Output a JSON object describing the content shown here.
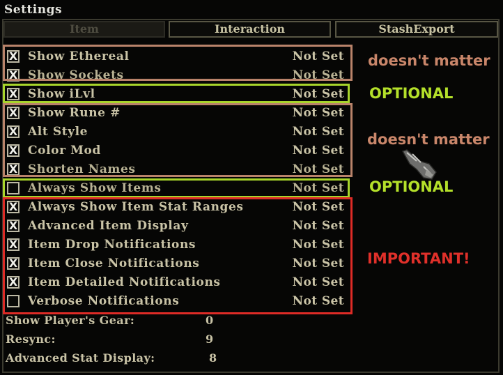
{
  "window": {
    "title": "Settings"
  },
  "tabs": [
    {
      "label": "Item",
      "active": true
    },
    {
      "label": "Interaction",
      "active": false
    },
    {
      "label": "StashExport",
      "active": false
    }
  ],
  "options": [
    {
      "label": "Show Ethereal",
      "value": "Not Set",
      "checked": true
    },
    {
      "label": "Show Sockets",
      "value": "Not Set",
      "checked": true
    },
    {
      "label": "Show iLvl",
      "value": "Not Set",
      "checked": true
    },
    {
      "label": "Show Rune #",
      "value": "Not Set",
      "checked": true
    },
    {
      "label": "Alt Style",
      "value": "Not Set",
      "checked": true
    },
    {
      "label": "Color Mod",
      "value": "Not Set",
      "checked": true
    },
    {
      "label": "Shorten Names",
      "value": "Not Set",
      "checked": true
    },
    {
      "label": "Always Show Items",
      "value": "Not Set",
      "checked": false
    },
    {
      "label": "Always Show Item Stat Ranges",
      "value": "Not Set",
      "checked": true
    },
    {
      "label": "Advanced Item Display",
      "value": "Not Set",
      "checked": true
    },
    {
      "label": "Item Drop Notifications",
      "value": "Not Set",
      "checked": true
    },
    {
      "label": "Item Close Notifications",
      "value": "Not Set",
      "checked": true
    },
    {
      "label": "Item Detailed Notifications",
      "value": "Not Set",
      "checked": true
    },
    {
      "label": "Verbose Notifications",
      "value": "Not Set",
      "checked": false
    }
  ],
  "checkbox_mark": "X",
  "stats": [
    {
      "label": "Show Player's Gear:",
      "value": "0"
    },
    {
      "label": "Resync:",
      "value": "9"
    },
    {
      "label": "Advanced Stat Display:",
      "value": "8"
    }
  ],
  "annotations": [
    {
      "text": "doesn't matter",
      "color": "#c9866a"
    },
    {
      "text": "OPTIONAL",
      "color": "#b4e02a"
    },
    {
      "text": "doesn't matter",
      "color": "#c9866a"
    },
    {
      "text": "OPTIONAL",
      "color": "#b4e02a"
    },
    {
      "text": "IMPORTANT!",
      "color": "#e0302a"
    }
  ],
  "colors": {
    "brown_box": "#b9836a",
    "green_box": "#a8d52b",
    "red_box": "#de2b26",
    "text_gold": "#c9c3a6"
  },
  "icons": {
    "cursor": "gauntlet-cursor-icon"
  }
}
